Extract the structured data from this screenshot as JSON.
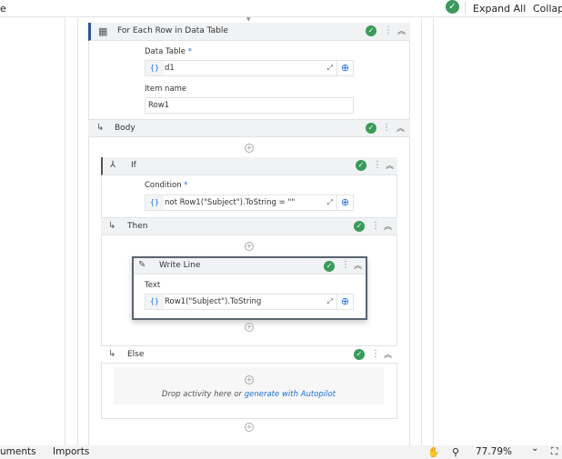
{
  "topbar": {
    "left_text": "e",
    "expand_all": "Expand All",
    "collapse": "Collap"
  },
  "foreach": {
    "title": "For Each Row in Data Table",
    "data_table_label": "Data Table",
    "required": "*",
    "data_table_value": "d1",
    "item_name_label": "Item name",
    "item_name_value": "Row1"
  },
  "body": {
    "title": "Body"
  },
  "if": {
    "title": "If",
    "condition_label": "Condition",
    "required": "*",
    "condition_value": "not Row1(\"Subject\").ToString = \"\""
  },
  "then": {
    "title": "Then"
  },
  "writeline": {
    "title": "Write Line",
    "text_label": "Text",
    "text_value": "Row1(\"Subject\").ToString"
  },
  "else": {
    "title": "Else",
    "drop_text": "Drop activity here or ",
    "drop_link": "generate with Autopilot"
  },
  "bottombar": {
    "arguments": "uments",
    "imports": "Imports",
    "zoom": "77.79%"
  },
  "icons": {
    "brace": "{}",
    "check": "✓",
    "plus": "+",
    "dots": "⋮",
    "chevrons": "︽",
    "arrow": "↳",
    "chevron_down": "⌄"
  }
}
